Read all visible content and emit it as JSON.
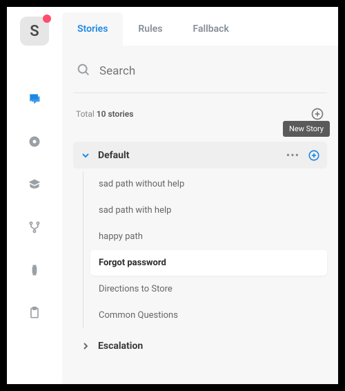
{
  "logo_letter": "S",
  "tabs": {
    "stories": "Stories",
    "rules": "Rules",
    "fallback": "Fallback"
  },
  "search": {
    "placeholder": "Search"
  },
  "total": {
    "prefix": "Total ",
    "count": "10 stories"
  },
  "tooltip_new_story": "New Story",
  "groups": [
    {
      "name": "Default",
      "expanded": true,
      "items": [
        "sad path without help",
        "sad path with help",
        "happy path",
        "Forgot password",
        "Directions to Store",
        "Common Questions"
      ],
      "active_index": 3
    },
    {
      "name": "Escalation",
      "expanded": false,
      "items": []
    }
  ],
  "colors": {
    "accent": "#1e88e5",
    "muted": "#9aa0a6"
  }
}
